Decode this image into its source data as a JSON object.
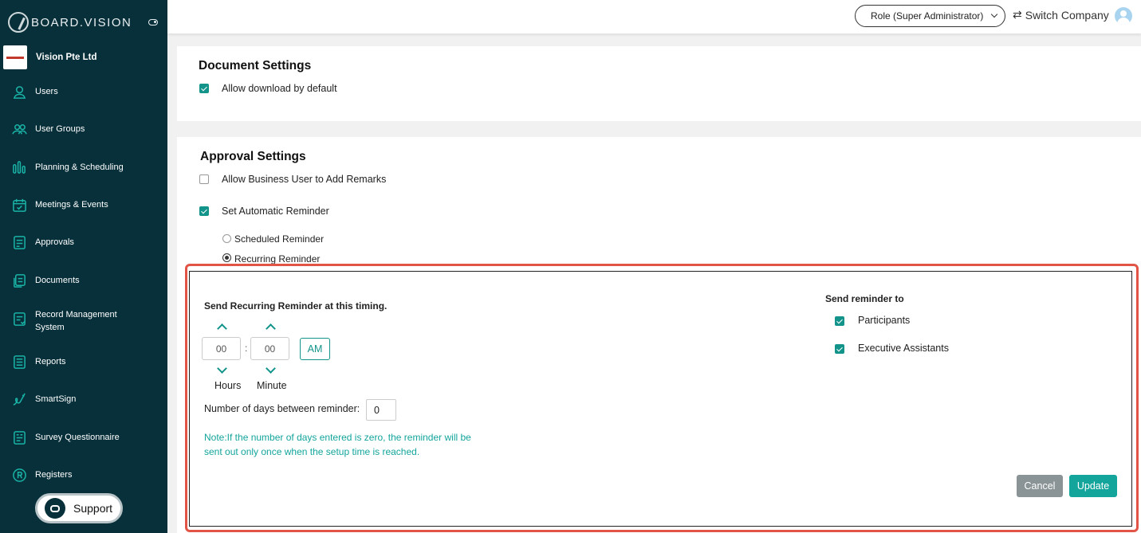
{
  "brand": {
    "name": "BOARD.VISION"
  },
  "company": {
    "name": "Vision Pte Ltd"
  },
  "sidebar": {
    "items": [
      {
        "label": "Users",
        "icon": "user-icon"
      },
      {
        "label": "User Groups",
        "icon": "users-icon"
      },
      {
        "label": "Planning & Scheduling",
        "icon": "bars-icon"
      },
      {
        "label": "Meetings & Events",
        "icon": "calendar-icon"
      },
      {
        "label": "Approvals",
        "icon": "document-check-icon"
      },
      {
        "label": "Documents",
        "icon": "documents-icon"
      },
      {
        "label": "Record Management System",
        "icon": "record-icon"
      },
      {
        "label": "Reports",
        "icon": "report-icon"
      },
      {
        "label": "SmartSign",
        "icon": "signature-icon"
      },
      {
        "label": "Survey Questionnaire",
        "icon": "survey-icon"
      },
      {
        "label": "Registers",
        "icon": "registered-icon"
      }
    ],
    "support_label": "Support"
  },
  "topbar": {
    "role_label": "Role (Super Administrator)",
    "switch_label": "Switch Company"
  },
  "document_settings": {
    "title": "Document Settings",
    "allow_download": {
      "label": "Allow download by default",
      "checked": true
    }
  },
  "approval_settings": {
    "title": "Approval Settings",
    "allow_remarks": {
      "label": "Allow Business User to Add Remarks",
      "checked": false
    },
    "auto_reminder": {
      "label": "Set Automatic Reminder",
      "checked": true
    },
    "scheduled_label": "Scheduled Reminder",
    "recurring_label": "Recurring Reminder",
    "selected_reminder": "Recurring Reminder"
  },
  "recurring_panel": {
    "title": "Send Recurring Reminder at this timing.",
    "hours_value": "00",
    "minutes_value": "00",
    "colon": ":",
    "ampm": "AM",
    "hours_label": "Hours",
    "minute_label": "Minute",
    "days_label": "Number of days between reminder:",
    "days_value": "0",
    "note": "Note:If the number of days entered is zero, the reminder will be sent out only once when the setup time is reached.",
    "send_to_title": "Send reminder to",
    "participants": {
      "label": "Participants",
      "checked": true
    },
    "executive_assistants": {
      "label": "Executive Assistants",
      "checked": true
    },
    "cancel_label": "Cancel",
    "update_label": "Update"
  },
  "colors": {
    "sidebar_bg": "#07303a",
    "accent": "#13948b",
    "highlight_outline": "#e25546"
  }
}
